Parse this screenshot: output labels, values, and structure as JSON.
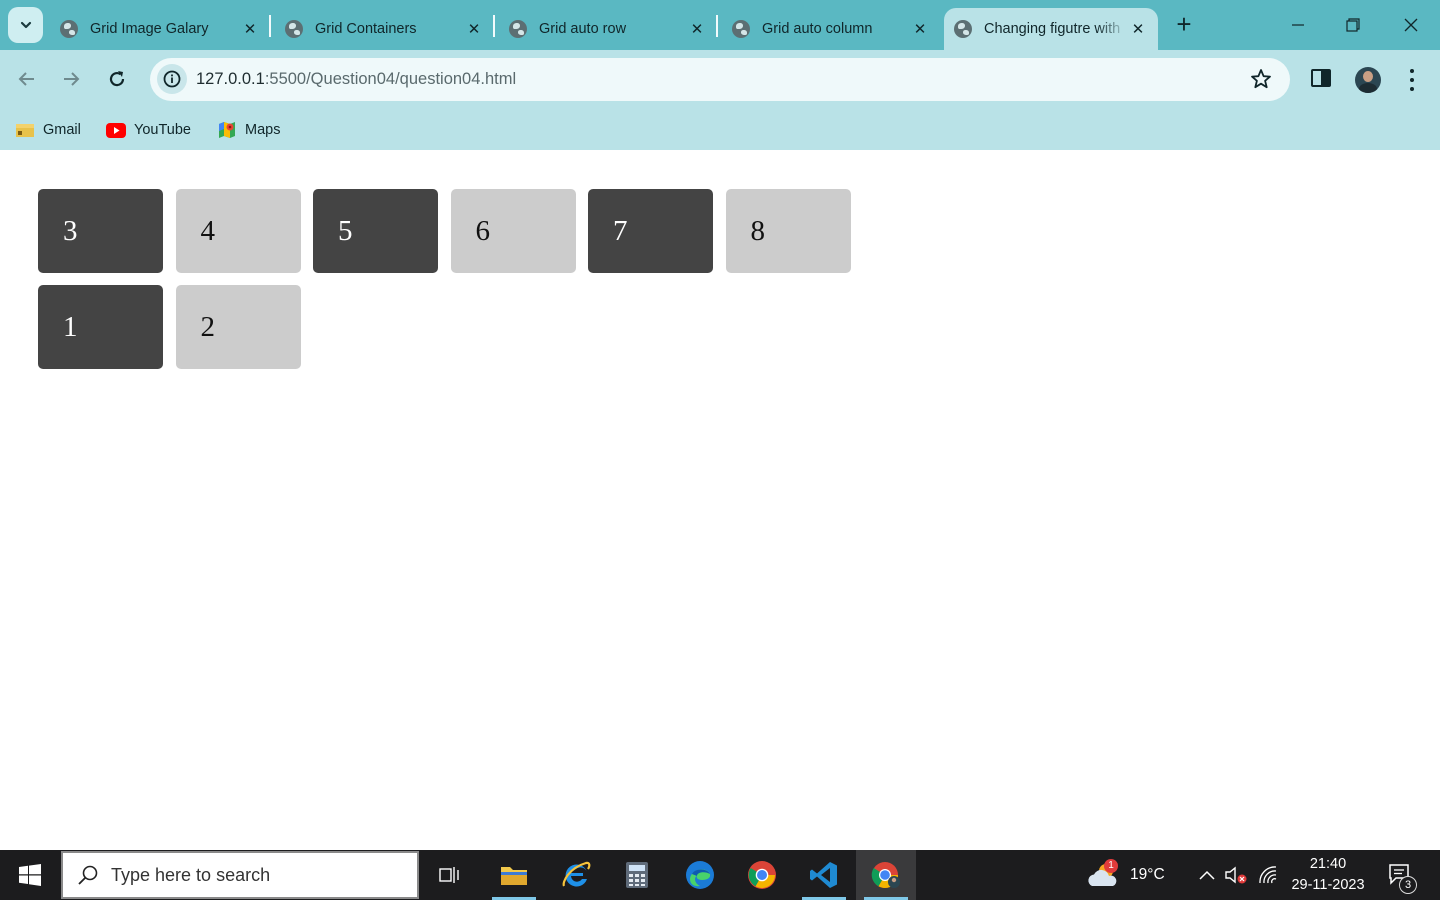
{
  "browser": {
    "tabs": [
      {
        "title": "Grid Image Galary",
        "active": false
      },
      {
        "title": "Grid Containers",
        "active": false
      },
      {
        "title": "Grid auto row",
        "active": false
      },
      {
        "title": "Grid auto column",
        "active": false
      },
      {
        "title": "Changing figutre with",
        "active": true
      }
    ],
    "url_host": "127.0.0.1",
    "url_path": ":5500/Question04/question04.html",
    "bookmarks": [
      {
        "label": "Gmail",
        "icon": "gmail-icon"
      },
      {
        "label": "YouTube",
        "icon": "youtube-icon"
      },
      {
        "label": "Maps",
        "icon": "maps-icon"
      }
    ]
  },
  "page": {
    "grid_items": [
      {
        "label": "3",
        "style": "dark"
      },
      {
        "label": "4",
        "style": "light"
      },
      {
        "label": "5",
        "style": "dark"
      },
      {
        "label": "6",
        "style": "light"
      },
      {
        "label": "7",
        "style": "dark"
      },
      {
        "label": "8",
        "style": "light"
      },
      {
        "label": "1",
        "style": "dark"
      },
      {
        "label": "2",
        "style": "light"
      }
    ],
    "colors": {
      "dark": "#444444",
      "light": "#cccccc"
    }
  },
  "taskbar": {
    "search_placeholder": "Type here to search",
    "weather_temp": "19°C",
    "weather_badge": "1",
    "time": "21:40",
    "date": "29-11-2023",
    "notification_count": "3"
  }
}
